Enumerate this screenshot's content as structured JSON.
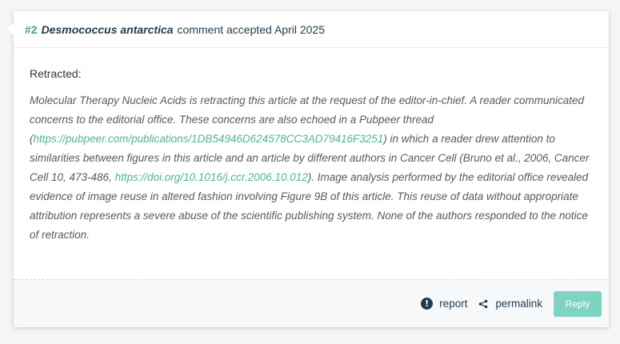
{
  "comment": {
    "number": "#2",
    "species": "Desmococcus antarctica",
    "status_text": "comment accepted April 2025"
  },
  "body": {
    "heading": "Retracted:",
    "text_part1": "Molecular Therapy Nucleic Acids is retracting this article at the request of the editor-in-chief. A reader communicated concerns to the editorial office. These concerns are also echoed in a Pubpeer thread (",
    "link1": "https://pubpeer.com/publications/1DB54946D624578CC3AD79416F3251",
    "text_part2": ") in which a reader drew attention to similarities between figures in this article and an article by different authors in Cancer Cell (Bruno et al., 2006, Cancer Cell 10, 473-486, ",
    "link2": "https://doi.org/10.1016/j.ccr.2006.10.012",
    "text_part3": "). Image analysis performed by the editorial office revealed evidence of image reuse in altered fashion involving Figure 9B of this article. This reuse of data without appropriate attribution represents a severe abuse of the scientific publishing system. None of the authors responded to the notice of retraction."
  },
  "footer": {
    "report_icon_glyph": "!",
    "report_label": "report",
    "permalink_label": "permalink",
    "reply_label": "Reply"
  },
  "colors": {
    "accent": "#3aa88c",
    "link": "#4fb39a",
    "reply_button": "#7fd3c2",
    "dark_text": "#1f3b4d"
  },
  "icons": {
    "report": "exclamation-circle-icon",
    "permalink": "share-icon"
  }
}
